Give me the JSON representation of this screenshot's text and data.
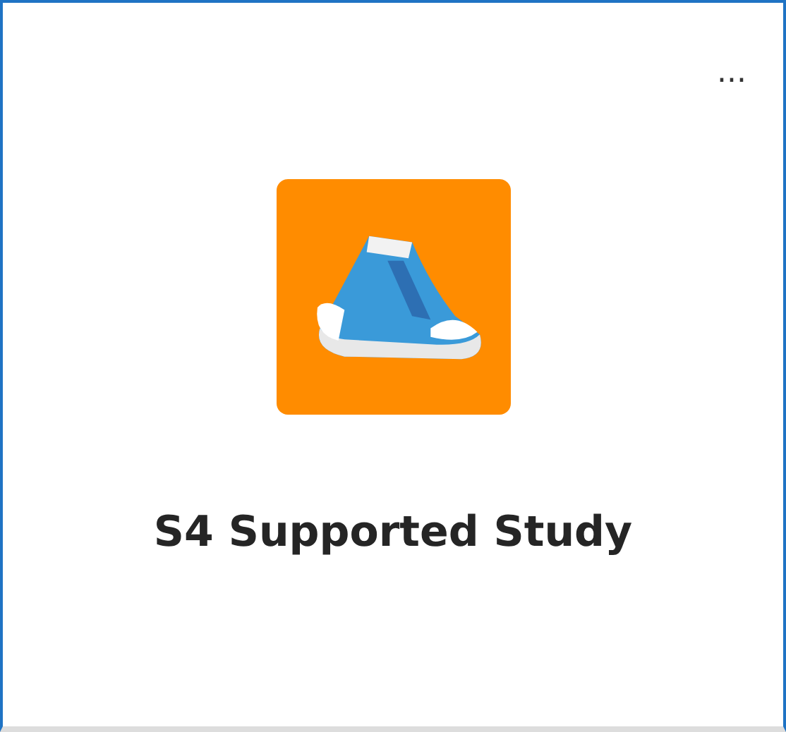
{
  "card": {
    "menu": "...",
    "title": "S4 Supported Study"
  }
}
